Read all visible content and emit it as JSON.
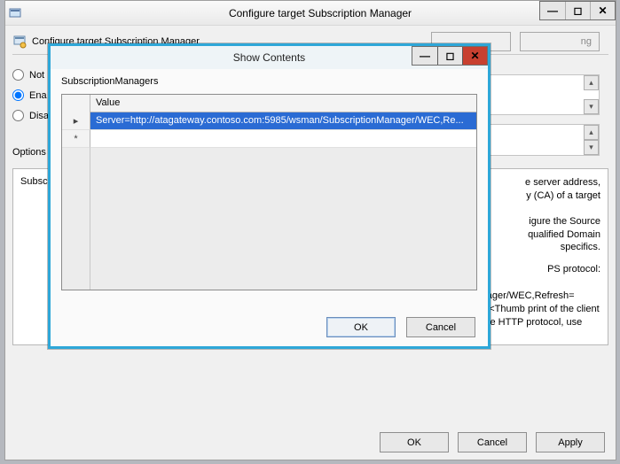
{
  "main": {
    "title": "Configure target Subscription Manager",
    "header": "Configure target Subscription Manager",
    "ghost_button_tail": "ng",
    "radios": {
      "not": "Not",
      "enabled": "Ena",
      "disabled": "Disa"
    },
    "options_label": "Options",
    "options_box_text": "Subscri",
    "desc_lines": {
      "l1": "e server address,",
      "l2": "y (CA) of a target",
      "l3": "igure the Source",
      "l4": "qualified Domain",
      "l5": "specifics.",
      "l6": "PS protocol:",
      "l7": "Server=https://<FQDN of the collector>:5986/wsman/SubscriptionManager/WEC,Refresh=<Refresh interval in seconds>,IssuerCA=<Thumb print of the client authentication certificate>. When using the HTTP protocol, use"
    },
    "footer": {
      "ok": "OK",
      "cancel": "Cancel",
      "apply": "Apply"
    }
  },
  "dialog": {
    "title": "Show Contents",
    "label": "SubscriptionManagers",
    "col_header": "Value",
    "rows": [
      "Server=http://atagateway.contoso.com:5985/wsman/SubscriptionManager/WEC,Re..."
    ],
    "row_marker_current": "▸",
    "row_marker_new": "*",
    "footer": {
      "ok": "OK",
      "cancel": "Cancel"
    }
  },
  "glyphs": {
    "min": "—",
    "max": "◻",
    "close": "✕",
    "up": "▴",
    "down": "▾"
  }
}
